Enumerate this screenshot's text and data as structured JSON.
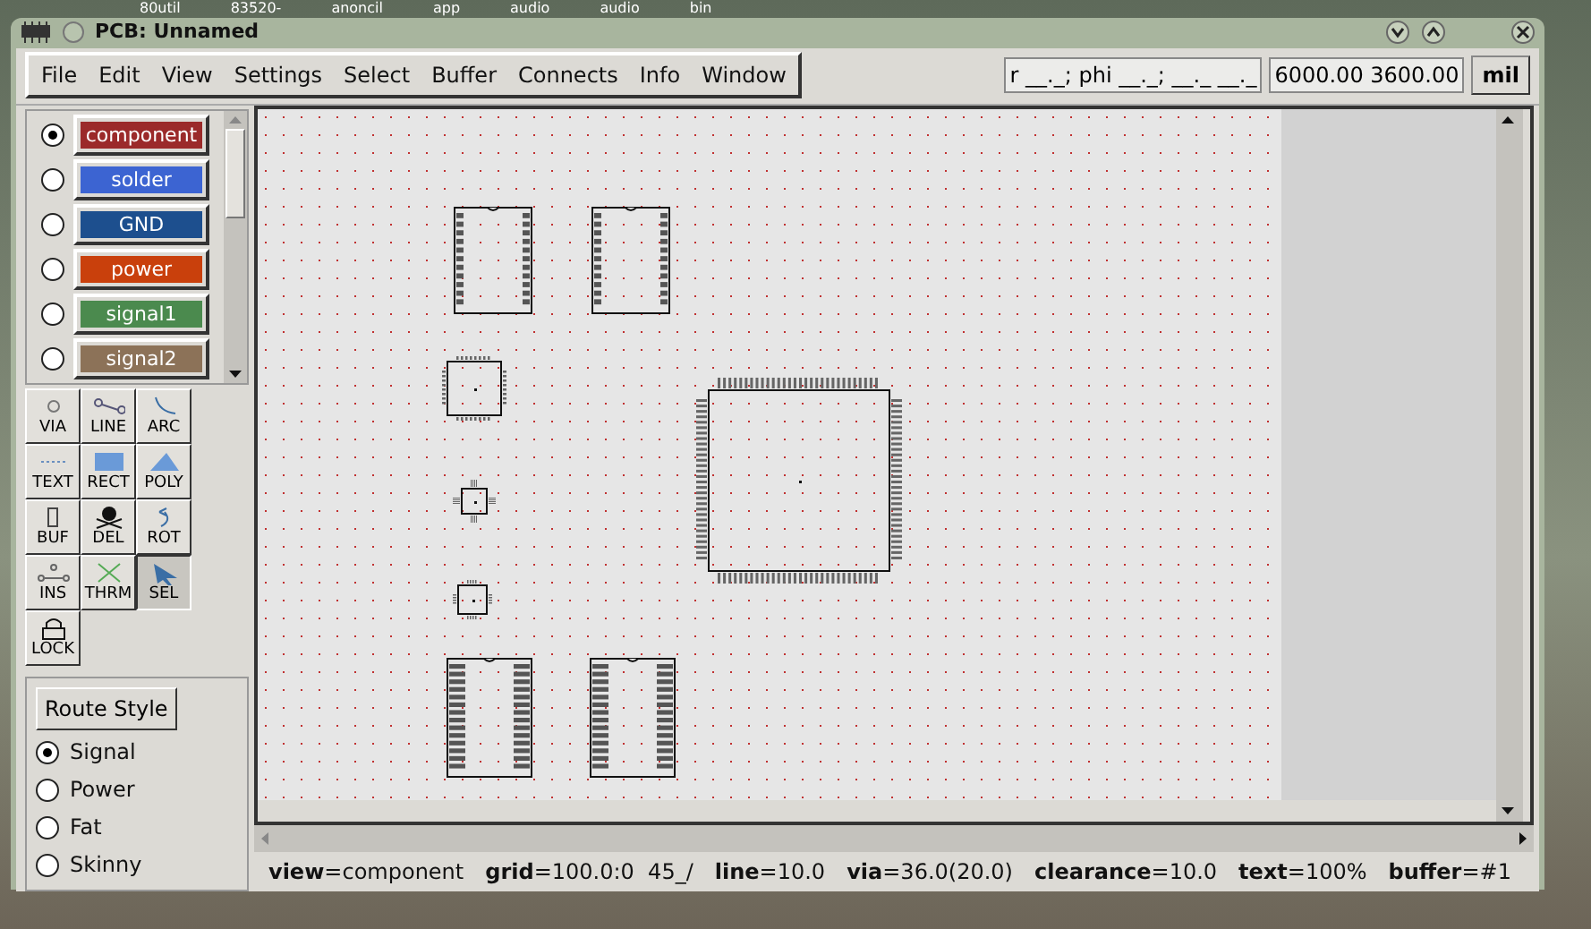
{
  "desktop_labels": [
    "80util",
    "83520-",
    "anoncil",
    "app",
    "audio",
    "audio",
    "bin"
  ],
  "window": {
    "title": "PCB:  Unnamed"
  },
  "menu": [
    "File",
    "Edit",
    "View",
    "Settings",
    "Select",
    "Buffer",
    "Connects",
    "Info",
    "Window"
  ],
  "coords": {
    "polar": "r __._; phi __._; __._ __._",
    "xy": "6000.00 3600.00",
    "units": "mil"
  },
  "layers": [
    {
      "label": "component",
      "color": "#9b2a2a",
      "selected": true
    },
    {
      "label": "solder",
      "color": "#3c64d2",
      "selected": false
    },
    {
      "label": "GND",
      "color": "#1d4f8e",
      "selected": false
    },
    {
      "label": "power",
      "color": "#c9400c",
      "selected": false
    },
    {
      "label": "signal1",
      "color": "#4b8a4e",
      "selected": false
    },
    {
      "label": "signal2",
      "color": "#8c7258",
      "selected": false
    }
  ],
  "tools": [
    {
      "label": "VIA",
      "kind": "via",
      "selected": false
    },
    {
      "label": "LINE",
      "kind": "line",
      "selected": false
    },
    {
      "label": "ARC",
      "kind": "arc",
      "selected": false
    },
    {
      "label": "TEXT",
      "kind": "text",
      "selected": false
    },
    {
      "label": "RECT",
      "kind": "rect",
      "selected": false
    },
    {
      "label": "POLY",
      "kind": "poly",
      "selected": false
    },
    {
      "label": "BUF",
      "kind": "buf",
      "selected": false
    },
    {
      "label": "DEL",
      "kind": "del",
      "selected": false
    },
    {
      "label": "ROT",
      "kind": "rot",
      "selected": false
    },
    {
      "label": "INS",
      "kind": "ins",
      "selected": false
    },
    {
      "label": "THRM",
      "kind": "thrm",
      "selected": false
    },
    {
      "label": "SEL",
      "kind": "sel",
      "selected": true
    },
    {
      "label": "LOCK",
      "kind": "lock",
      "selected": false
    }
  ],
  "route_style": {
    "button": "Route Style",
    "options": [
      {
        "label": "Signal",
        "selected": true
      },
      {
        "label": "Power",
        "selected": false
      },
      {
        "label": "Fat",
        "selected": false
      },
      {
        "label": "Skinny",
        "selected": false
      }
    ]
  },
  "status": [
    {
      "key": "view",
      "value": "=component"
    },
    {
      "key": "grid",
      "value": "=100.0:0  45_/"
    },
    {
      "key": "line",
      "value": "=10.0"
    },
    {
      "key": "via",
      "value": "=36.0(20.0)"
    },
    {
      "key": "clearance",
      "value": "=10.0"
    },
    {
      "key": "text",
      "value": "=100%"
    },
    {
      "key": "buffer",
      "value": "=#1"
    }
  ]
}
